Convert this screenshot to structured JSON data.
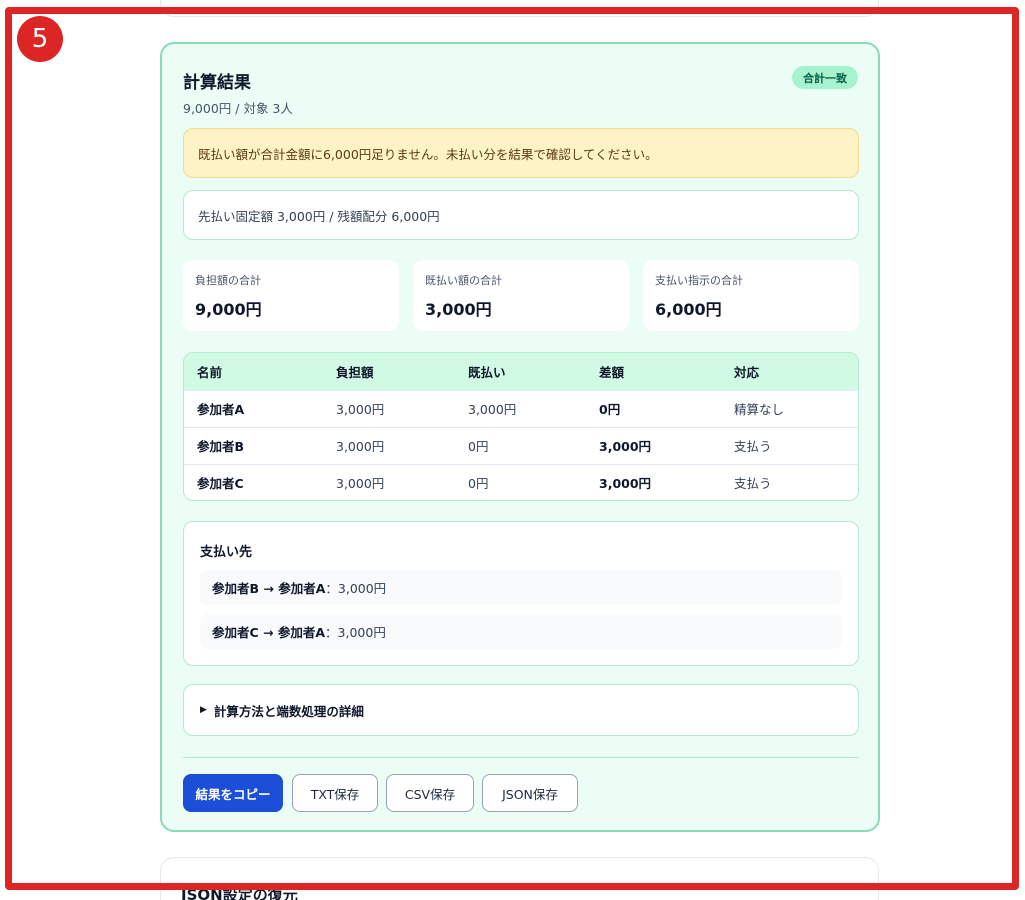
{
  "step_badge": "5",
  "result": {
    "title": "計算結果",
    "subtitle": "9,000円 / 対象 3人",
    "status": "合計一致",
    "warning": "既払い額が合計金額に6,000円足りません。未払い分を結果で確認してください。",
    "breakdown": "先払い固定額 3,000円 / 残額配分 6,000円",
    "stats": [
      {
        "label": "負担額の合計",
        "value": "9,000円"
      },
      {
        "label": "既払い額の合計",
        "value": "3,000円"
      },
      {
        "label": "支払い指示の合計",
        "value": "6,000円"
      }
    ],
    "table": {
      "headers": [
        "名前",
        "負担額",
        "既払い",
        "差額",
        "対応"
      ],
      "rows": [
        [
          "参加者A",
          "3,000円",
          "3,000円",
          "0円",
          "精算なし"
        ],
        [
          "参加者B",
          "3,000円",
          "0円",
          "3,000円",
          "支払う"
        ],
        [
          "参加者C",
          "3,000円",
          "0円",
          "3,000円",
          "支払う"
        ]
      ]
    },
    "payees": {
      "title": "支払い先",
      "items": [
        {
          "route": "参加者B → 参加者A",
          "amount": "：3,000円"
        },
        {
          "route": "参加者C → 参加者A",
          "amount": "：3,000円"
        }
      ]
    },
    "details_toggle": "計算方法と端数処理の詳細",
    "buttons": {
      "copy": "結果をコピー",
      "txt": "TXT保存",
      "csv": "CSV保存",
      "json": "JSON保存"
    }
  },
  "next_section": {
    "title": "JSON設定の復元"
  }
}
